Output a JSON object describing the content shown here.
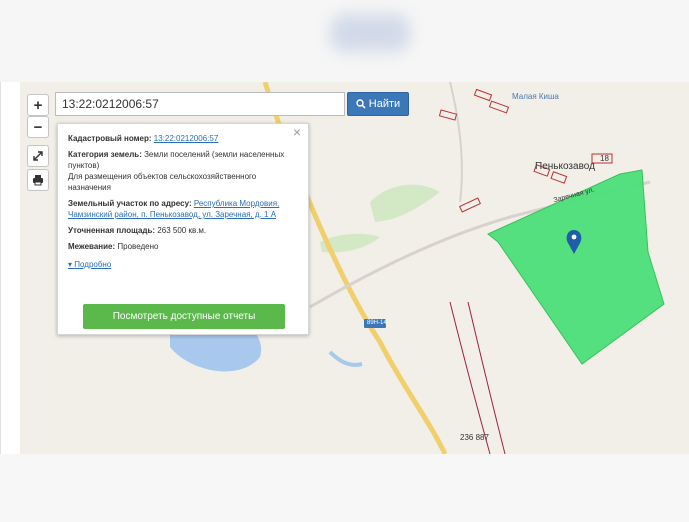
{
  "search": {
    "value": "13:22:0212006:57",
    "button_label": "Найти"
  },
  "controls": {
    "zoom_in": "+",
    "zoom_out": "−"
  },
  "popup": {
    "close": "×",
    "cadastral_label": "Кадастровый номер:",
    "cadastral_value": "13:22:0212006:57",
    "category_label": "Категория земель:",
    "category_value": "Земли поселений (земли населенных пунктов)",
    "category_use": "Для размещения объектов сельскохозяйственного назначения",
    "address_label": "Земельный участок по адресу:",
    "address_value": "Республика Мордовия, Чамзинский район, п. Пенькозавод, ул. Заречная, д. 1 А",
    "area_label": "Уточненная площадь:",
    "area_value": "263 500 кв.м.",
    "survey_label": "Межевание:",
    "survey_value": "Проведено",
    "more": "Подробно",
    "report_button": "Посмотреть доступные отчеты"
  },
  "map_labels": {
    "village": "Пенькозавод",
    "river": "Малая Киша",
    "street": "Заречная ул.",
    "road": "89Н-14",
    "house": "18",
    "pins": "236  887"
  },
  "colors": {
    "parcel": "#4de07a",
    "accent": "#3c78b8",
    "button": "#5ab94a"
  },
  "icons": [
    "zoom-in-icon",
    "zoom-out-icon",
    "fullscreen-icon",
    "print-icon",
    "search-icon",
    "location-pin-icon",
    "close-icon"
  ]
}
